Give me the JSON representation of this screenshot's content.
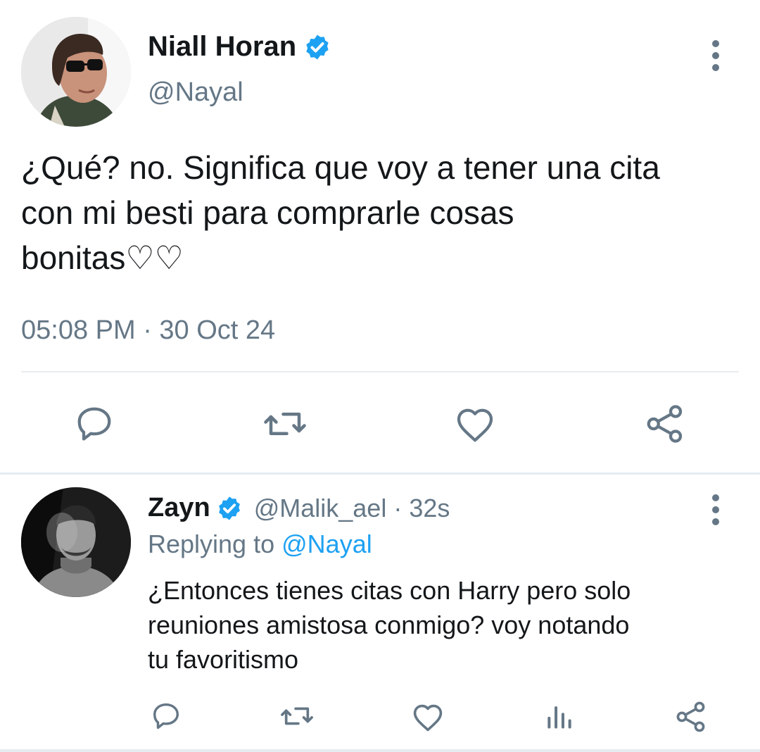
{
  "main_tweet": {
    "author_name": "Niall Horan",
    "handle": "@Nayal",
    "text_lines": [
      "¿Qué? no. Significa que voy a tener una cita",
      "con mi besti para comprarle cosas",
      "bonitas♡♡"
    ],
    "timestamp": "05:08 PM · 30 Oct 24",
    "actions": [
      "reply-icon",
      "retweet-icon",
      "like-icon",
      "share-icon"
    ]
  },
  "reply_tweet": {
    "author_name": "Zayn",
    "handle": "@Malik_ael",
    "time_sep": "·",
    "time": "32s",
    "replying_prefix": "Replying to",
    "replying_to": "@Nayal",
    "text_lines": [
      "¿Entonces tienes citas con Harry pero solo",
      "reuniones amistosa conmigo? voy notando",
      "tu favoritismo"
    ],
    "actions": [
      "reply-icon",
      "retweet-icon",
      "like-icon",
      "analytics-icon",
      "share-icon"
    ]
  },
  "colors": {
    "verified": "#1da1f2",
    "link": "#1da1f2",
    "muted": "#657786",
    "icon": "#657786",
    "text": "#14171a"
  }
}
